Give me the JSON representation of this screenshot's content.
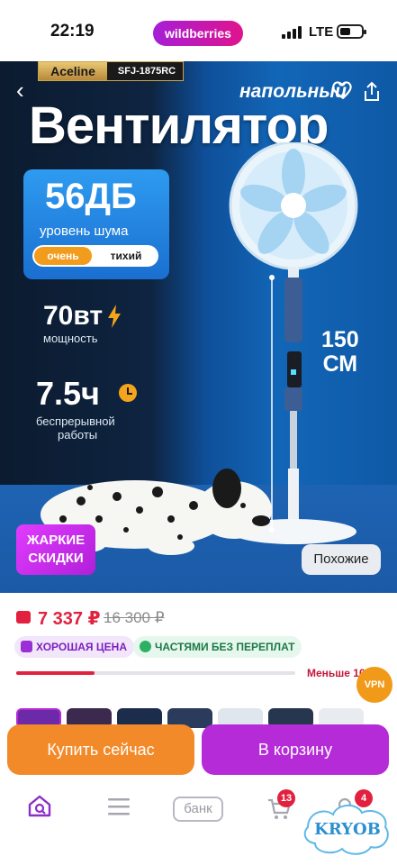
{
  "status_bar": {
    "time": "22:19",
    "brand": "wildberries",
    "network": "LTE"
  },
  "product_image": {
    "brand_name": "Aceline",
    "model": "SFJ-1875RC",
    "subtitle": "напольный",
    "title": "Вентилятор",
    "noise_value": "56ДБ",
    "noise_label": "уровень шума",
    "noise_tag_1": "очень",
    "noise_tag_2": "тихий",
    "power_value": "70вт",
    "power_label": "мощность",
    "runtime_value": "7.5ч",
    "runtime_label_1": "беспрерывной",
    "runtime_label_2": "работы",
    "height_value": "150",
    "height_unit": "СМ",
    "promo_line_1": "ЖАРКИЕ",
    "promo_line_2": "СКИДКИ",
    "similar_button": "Похожие"
  },
  "price": {
    "current": "7 337 ₽",
    "old": "16 300 ₽",
    "badge_good": "ХОРОШАЯ ЦЕНА",
    "badge_installments": "ЧАСТЯМИ БЕЗ ПЕРЕПЛАТ",
    "stock_progress": 0.28,
    "stock_label": "Меньше 10"
  },
  "vpn_label": "VPN",
  "actions": {
    "buy_now": "Купить сейчас",
    "add_to_cart": "В корзину"
  },
  "tabbar": {
    "bank_label": "банк",
    "cart_count": "13",
    "profile_count": "4"
  },
  "watermark": "KRYOB",
  "colors": {
    "accent_purple": "#b52bd8",
    "accent_orange": "#f28a2a",
    "price_red": "#e2213e"
  }
}
